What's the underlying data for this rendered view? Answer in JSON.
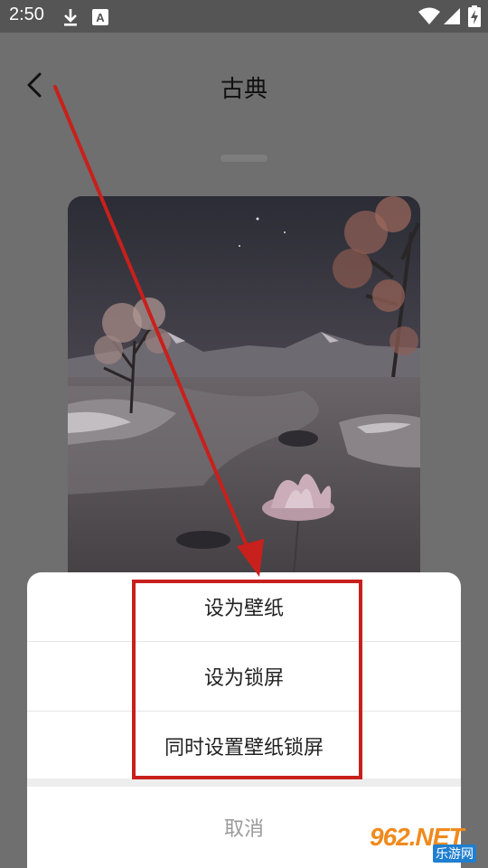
{
  "status_bar": {
    "time": "2:50",
    "icons": [
      "download-icon",
      "font-a-icon",
      "wifi-icon",
      "signal-icon",
      "battery-charging-icon"
    ],
    "font_icon_glyph": "A"
  },
  "header": {
    "title": "古典",
    "back_icon": "chevron-left-icon"
  },
  "sheet": {
    "options": [
      {
        "label": "设为壁纸"
      },
      {
        "label": "设为锁屏"
      },
      {
        "label": "同时设置壁纸锁屏"
      }
    ],
    "cancel_label": "取消"
  },
  "annotation": {
    "color": "#c8201c"
  },
  "watermark": {
    "main": "962.NET",
    "sub": "乐游网"
  }
}
